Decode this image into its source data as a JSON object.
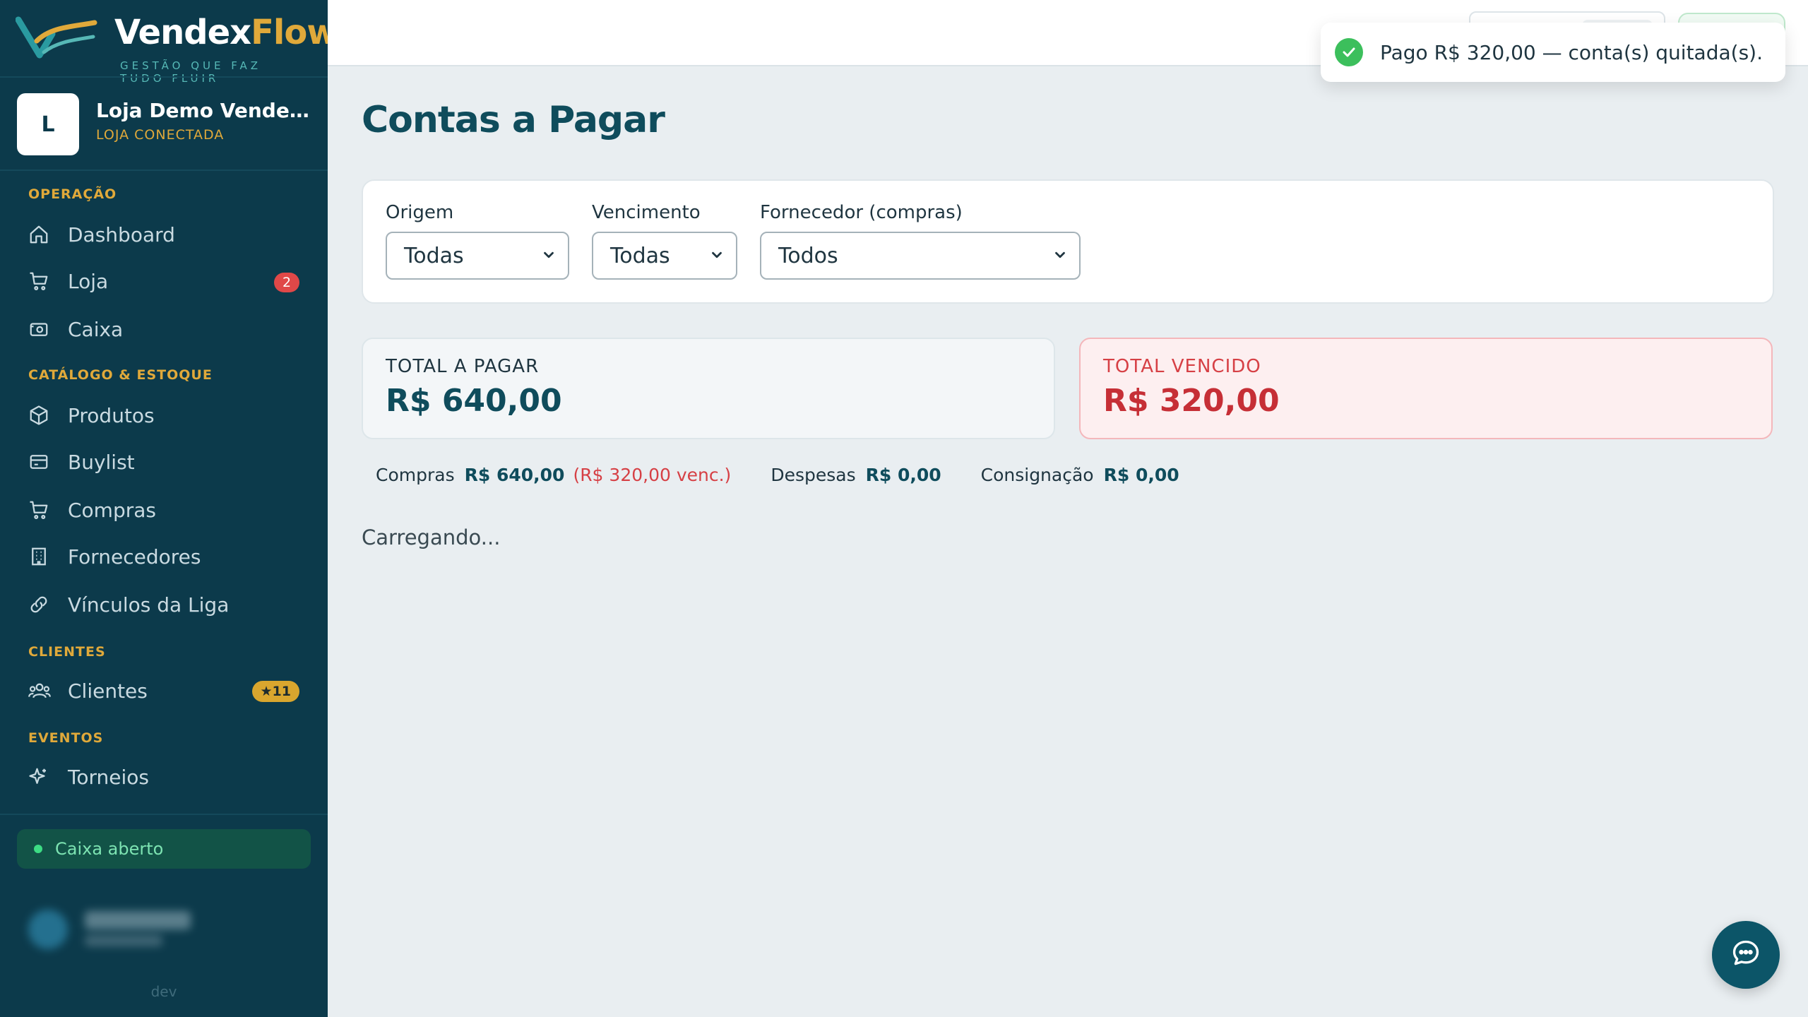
{
  "brand": {
    "name_main": "Vendex",
    "name_accent": "Flow",
    "tagline": "GESTÃO QUE FAZ TUDO FLUIR"
  },
  "store": {
    "initial": "L",
    "name": "Loja Demo VendexFlow",
    "status": "LOJA CONECTADA"
  },
  "sidebar": {
    "sections": [
      {
        "label": "OPERAÇÃO"
      },
      {
        "label": "CATÁLOGO & ESTOQUE"
      },
      {
        "label": "CLIENTES"
      },
      {
        "label": "EVENTOS"
      }
    ],
    "items": [
      {
        "label": "Dashboard",
        "icon": "home-icon"
      },
      {
        "label": "Loja",
        "icon": "cart-icon",
        "badge": "2"
      },
      {
        "label": "Caixa",
        "icon": "cash-register-icon"
      },
      {
        "label": "Produtos",
        "icon": "box-icon"
      },
      {
        "label": "Buylist",
        "icon": "card-icon"
      },
      {
        "label": "Compras",
        "icon": "cart-icon"
      },
      {
        "label": "Fornecedores",
        "icon": "building-icon"
      },
      {
        "label": "Vínculos da Liga",
        "icon": "link-icon"
      },
      {
        "label": "Clientes",
        "icon": "users-icon",
        "badge": "★11"
      },
      {
        "label": "Torneios",
        "icon": "sparkle-icon"
      }
    ],
    "caixa_status": "Caixa aberto",
    "env": "dev"
  },
  "toast": {
    "message": "Pago R$ 320,00 — conta(s) quitada(s)."
  },
  "page": {
    "title": "Contas a Pagar",
    "loading": "Carregando..."
  },
  "filters": {
    "origem": {
      "label": "Origem",
      "value": "Todas"
    },
    "vencimento": {
      "label": "Vencimento",
      "value": "Todas"
    },
    "fornecedor": {
      "label": "Fornecedor (compras)",
      "value": "Todos"
    }
  },
  "summary": {
    "total_a_pagar": {
      "label": "TOTAL A PAGAR",
      "value": "R$ 640,00"
    },
    "total_vencido": {
      "label": "TOTAL VENCIDO",
      "value": "R$ 320,00"
    }
  },
  "breakdown": {
    "compras": {
      "label": "Compras",
      "value": "R$ 640,00",
      "venc": "(R$ 320,00 venc.)"
    },
    "despesas": {
      "label": "Despesas",
      "value": "R$ 0,00"
    },
    "consignacao": {
      "label": "Consignação",
      "value": "R$ 0,00"
    }
  },
  "colors": {
    "sidebar_bg": "#0c3a4b",
    "accent_gold": "#e0a93a",
    "primary_teal": "#0f4c5c",
    "danger": "#c62f36",
    "success": "#3cbf5c"
  }
}
